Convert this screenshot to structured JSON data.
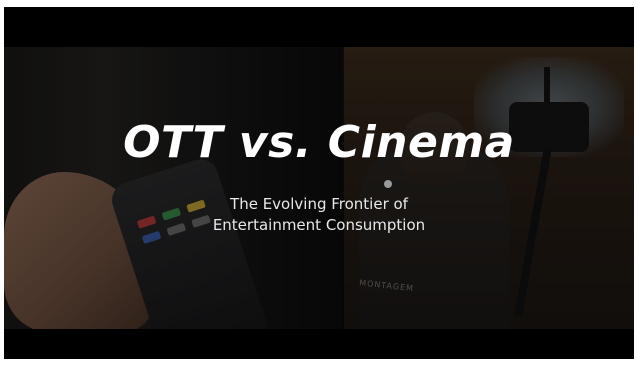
{
  "video": {
    "title": "OTT vs. Cinema",
    "subtitle_line1": "The Evolving Frontier of",
    "subtitle_line2": "Entertainment Consumption",
    "vest_text": "MONTAGEM"
  },
  "colors": {
    "title": "#ffffff",
    "subtitle": "#e8e8e8",
    "letterbox": "#000000"
  },
  "icons": {
    "remote": "tv-remote-icon",
    "camera": "video-camera-icon"
  }
}
